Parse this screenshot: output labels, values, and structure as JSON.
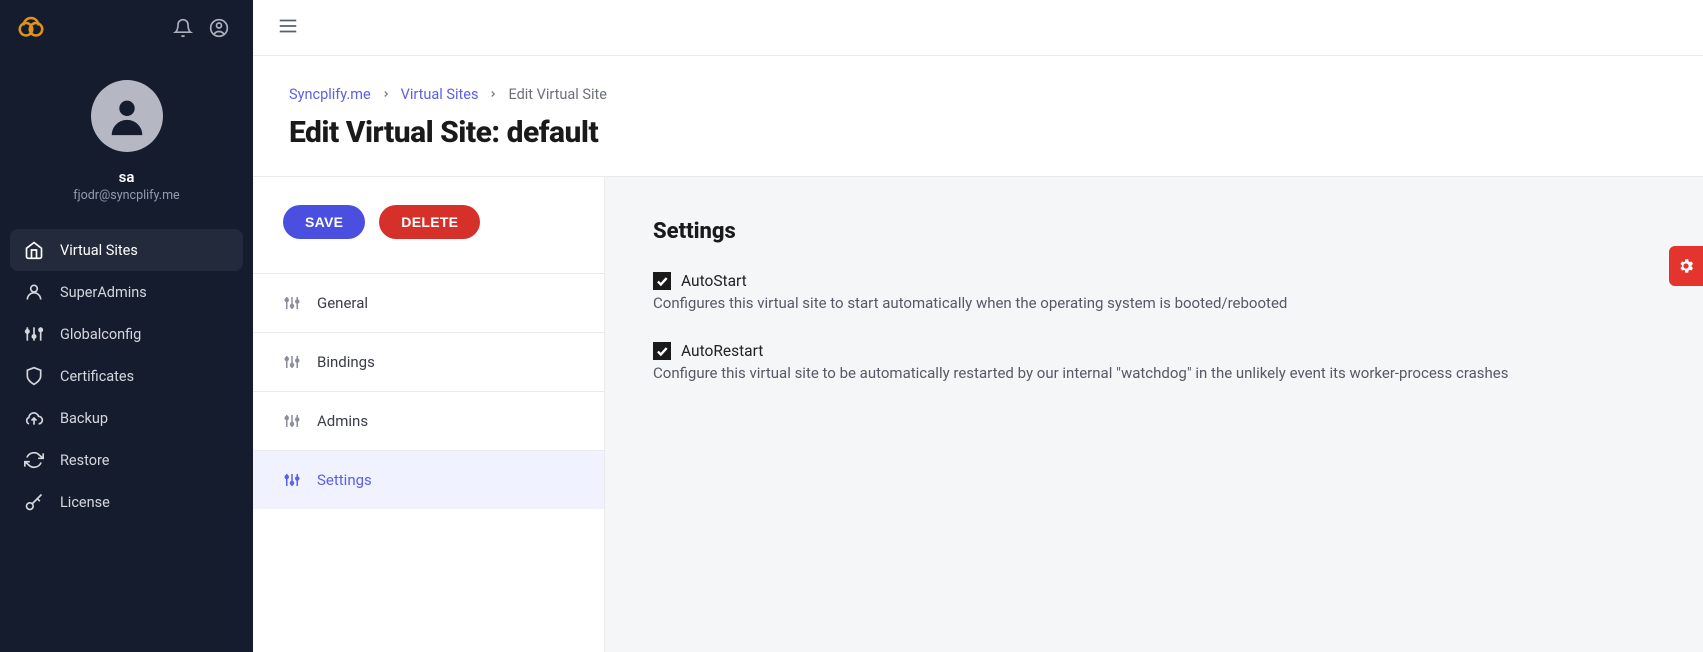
{
  "sidebar": {
    "user": {
      "name": "sa",
      "email": "fjodr@syncplify.me"
    },
    "items": [
      {
        "label": "Virtual Sites"
      },
      {
        "label": "SuperAdmins"
      },
      {
        "label": "Globalconfig"
      },
      {
        "label": "Certificates"
      },
      {
        "label": "Backup"
      },
      {
        "label": "Restore"
      },
      {
        "label": "License"
      }
    ]
  },
  "breadcrumb": {
    "a": "Syncplify.me",
    "b": "Virtual Sites",
    "c": "Edit Virtual Site"
  },
  "page_title": "Edit Virtual Site: default",
  "actions": {
    "save": "SAVE",
    "delete": "DELETE"
  },
  "subnav": {
    "general": "General",
    "bindings": "Bindings",
    "admins": "Admins",
    "settings": "Settings"
  },
  "settings_panel": {
    "title": "Settings",
    "autostart": {
      "label": "AutoStart",
      "desc": "Configures this virtual site to start automatically when the operating system is booted/rebooted",
      "checked": true
    },
    "autorestart": {
      "label": "AutoRestart",
      "desc": "Configure this virtual site to be automatically restarted by our internal \"watchdog\" in the unlikely event its worker-process crashes",
      "checked": true
    }
  }
}
